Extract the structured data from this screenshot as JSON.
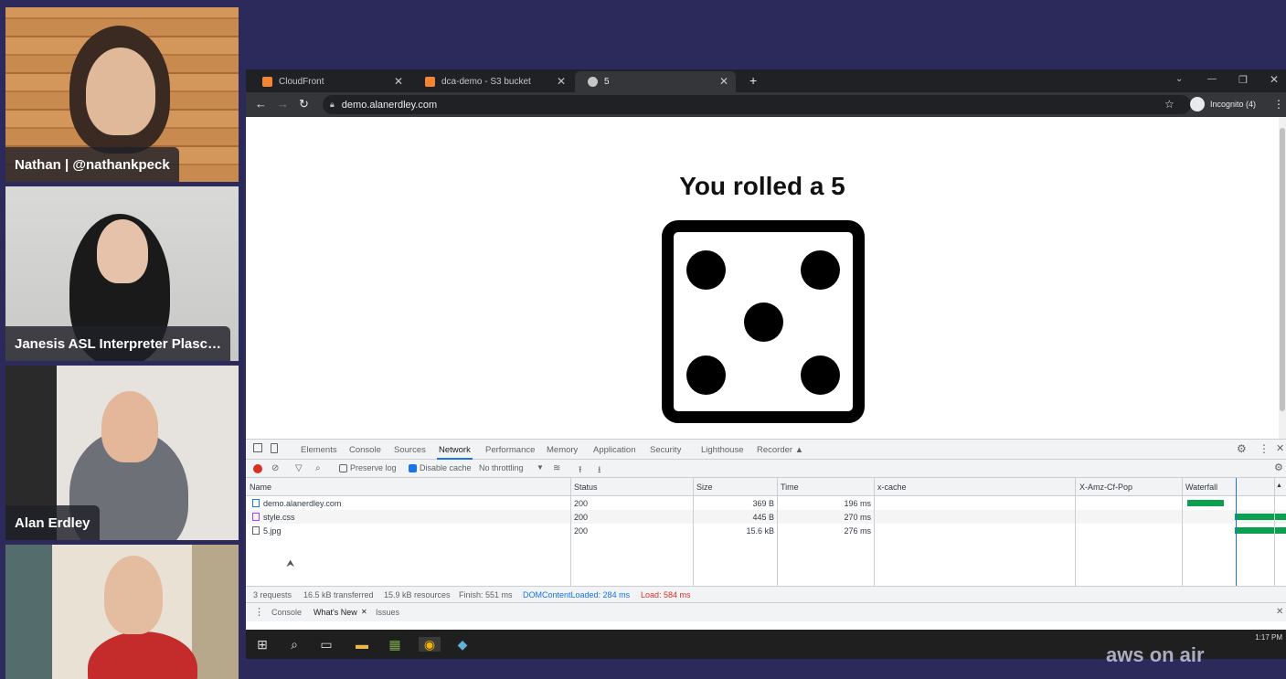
{
  "participants": [
    {
      "name": "Nathan | @nathankpeck"
    },
    {
      "name": "Janesis ASL Interpreter Plasc…"
    },
    {
      "name": "Alan Erdley"
    },
    {
      "name": ""
    }
  ],
  "browser": {
    "tabs": [
      {
        "label": "CloudFront",
        "close": "✕"
      },
      {
        "label": "dca-demo - S3 bucket",
        "close": "✕"
      },
      {
        "label": "5",
        "close": "✕"
      }
    ],
    "new_tab": "+",
    "url": "demo.alanerdley.com",
    "incognito": "Incognito (4)",
    "window_controls": {
      "minimize": "—",
      "restore": "❐",
      "close": "✕"
    }
  },
  "page": {
    "headline": "You rolled a 5",
    "die_value": 5
  },
  "devtools": {
    "tabs": [
      "Elements",
      "Console",
      "Sources",
      "Network",
      "Performance",
      "Memory",
      "Application",
      "Security",
      "Lighthouse",
      "Recorder ▲"
    ],
    "active_tab": "Network",
    "toolbar": {
      "preserve_log": "Preserve log",
      "disable_cache": "Disable cache",
      "throttling": "No throttling"
    },
    "columns": [
      "Name",
      "Status",
      "Size",
      "Time",
      "x-cache",
      "X-Amz-Cf-Pop",
      "Waterfall"
    ],
    "rows": [
      {
        "name": "demo.alanerdley.com",
        "status": "200",
        "size": "369 B",
        "time": "196 ms"
      },
      {
        "name": "style.css",
        "status": "200",
        "size": "445 B",
        "time": "270 ms"
      },
      {
        "name": "5.jpg",
        "status": "200",
        "size": "15.6 kB",
        "time": "276 ms"
      }
    ],
    "summary": {
      "requests": "3 requests",
      "transferred": "16.5 kB transferred",
      "resources": "15.9 kB resources",
      "finish": "Finish: 551 ms",
      "dom": "DOMContentLoaded: 284 ms",
      "load": "Load: 584 ms"
    },
    "drawer_tabs": [
      "Console",
      "What's New",
      "Issues"
    ]
  },
  "taskbar": {
    "time": "1:17 PM"
  },
  "brand": {
    "text": "aws on air"
  },
  "colors": {
    "accent": "#1a73e8",
    "record": "#d93025",
    "waterfall": "#0b9f50",
    "background": "#2c2a5a"
  }
}
